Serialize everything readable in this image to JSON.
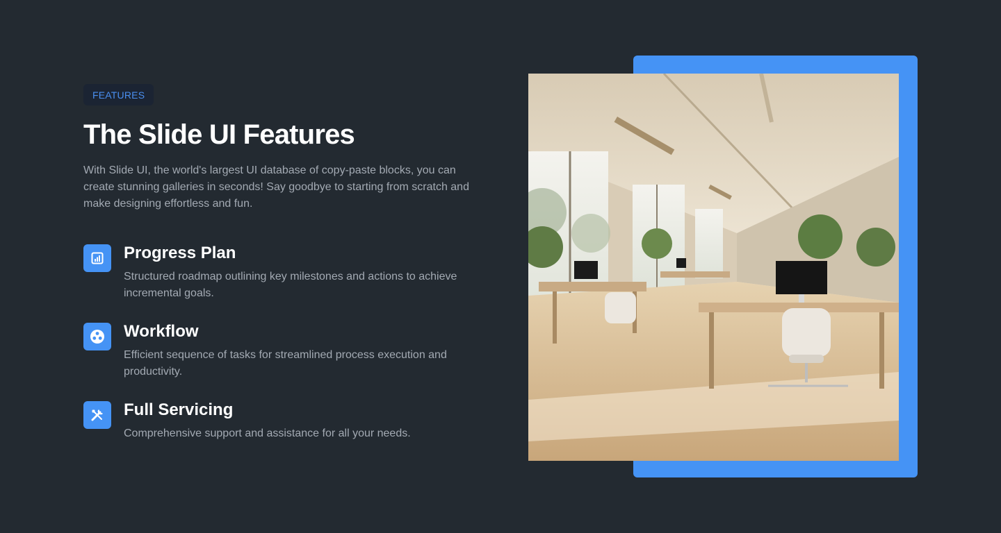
{
  "section": {
    "badge": "FEATURES",
    "title": "The Slide UI Features",
    "description": "With Slide UI, the world's largest UI database of copy-paste blocks, you can create stunning galleries in seconds! Say goodbye to starting from scratch and make designing effortless and fun."
  },
  "features": [
    {
      "icon": "chart-icon",
      "title": "Progress Plan",
      "description": "Structured roadmap outlining key milestones and actions to achieve incremental goals."
    },
    {
      "icon": "workflow-icon",
      "title": "Workflow",
      "description": "Efficient sequence of tasks for streamlined process execution and productivity."
    },
    {
      "icon": "tools-icon",
      "title": "Full Servicing",
      "description": "Comprehensive support and assistance for all your needs."
    }
  ],
  "image": {
    "subject": "office-interior-photo"
  },
  "colors": {
    "background": "#232a31",
    "accent": "#4593f5",
    "badge_bg": "#1b2433",
    "badge_text": "#4a8ff0",
    "muted_text": "#a3aab3"
  }
}
